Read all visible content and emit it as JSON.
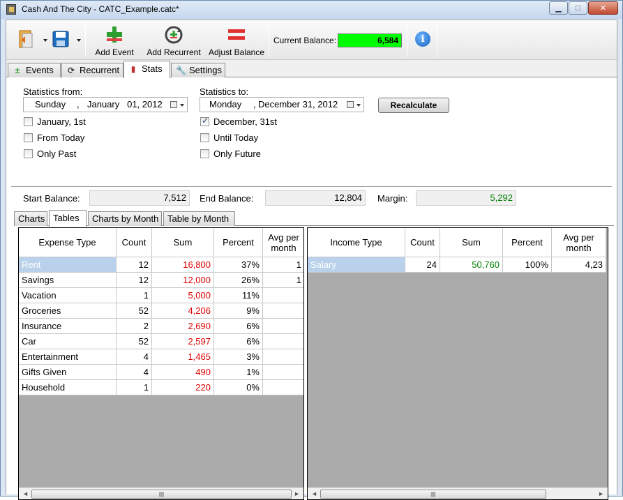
{
  "window": {
    "title": "Cash And The City - CATC_Example.catc*"
  },
  "toolbar": {
    "add_event": "Add Event",
    "add_recurrent": "Add Recurrent",
    "adjust_balance": "Adjust Balance",
    "current_balance_label": "Current Balance:",
    "current_balance_value": "6,584",
    "balance_color": "#00ff00"
  },
  "main_tabs": [
    "Events",
    "Recurrent",
    "Stats",
    "Settings"
  ],
  "stats": {
    "from_label": "Statistics from:",
    "from_day": "Sunday",
    "from_sep": ",",
    "from_date": "January   01, 2012",
    "to_label": "Statistics to:",
    "to_day": "Monday",
    "to_sep": ",",
    "to_date": "December 31, 2012",
    "recalculate": "Recalculate",
    "from_checks": [
      {
        "label": "January, 1st",
        "checked": false
      },
      {
        "label": "From Today",
        "checked": false
      },
      {
        "label": "Only Past",
        "checked": false
      }
    ],
    "to_checks": [
      {
        "label": "December, 31st",
        "checked": true
      },
      {
        "label": "Until Today",
        "checked": false
      },
      {
        "label": "Only Future",
        "checked": false
      }
    ],
    "start_balance_label": "Start Balance:",
    "start_balance": "7,512",
    "end_balance_label": "End Balance:",
    "end_balance": "12,804",
    "margin_label": "Margin:",
    "margin": "5,292"
  },
  "sub_tabs": [
    "Charts",
    "Tables",
    "Charts by Month",
    "Table by Month"
  ],
  "expense_table": {
    "headers": [
      "Expense Type",
      "Count",
      "Sum",
      "Percent",
      "Avg per month"
    ],
    "rows": [
      [
        "Rent",
        "12",
        "16,800",
        "37%",
        "1"
      ],
      [
        "Savings",
        "12",
        "12,000",
        "26%",
        "1"
      ],
      [
        "Vacation",
        "1",
        "5,000",
        "11%",
        ""
      ],
      [
        "Groceries",
        "52",
        "4,206",
        "9%",
        ""
      ],
      [
        "Insurance",
        "2",
        "2,690",
        "6%",
        ""
      ],
      [
        "Car",
        "52",
        "2,597",
        "6%",
        ""
      ],
      [
        "Entertainment",
        "4",
        "1,465",
        "3%",
        ""
      ],
      [
        "Gifts Given",
        "4",
        "490",
        "1%",
        ""
      ],
      [
        "Household",
        "1",
        "220",
        "0%",
        ""
      ]
    ]
  },
  "income_table": {
    "headers": [
      "Income Type",
      "Count",
      "Sum",
      "Percent",
      "Avg per month"
    ],
    "rows": [
      [
        "Salary",
        "24",
        "50,760",
        "100%",
        "4,23"
      ]
    ]
  }
}
